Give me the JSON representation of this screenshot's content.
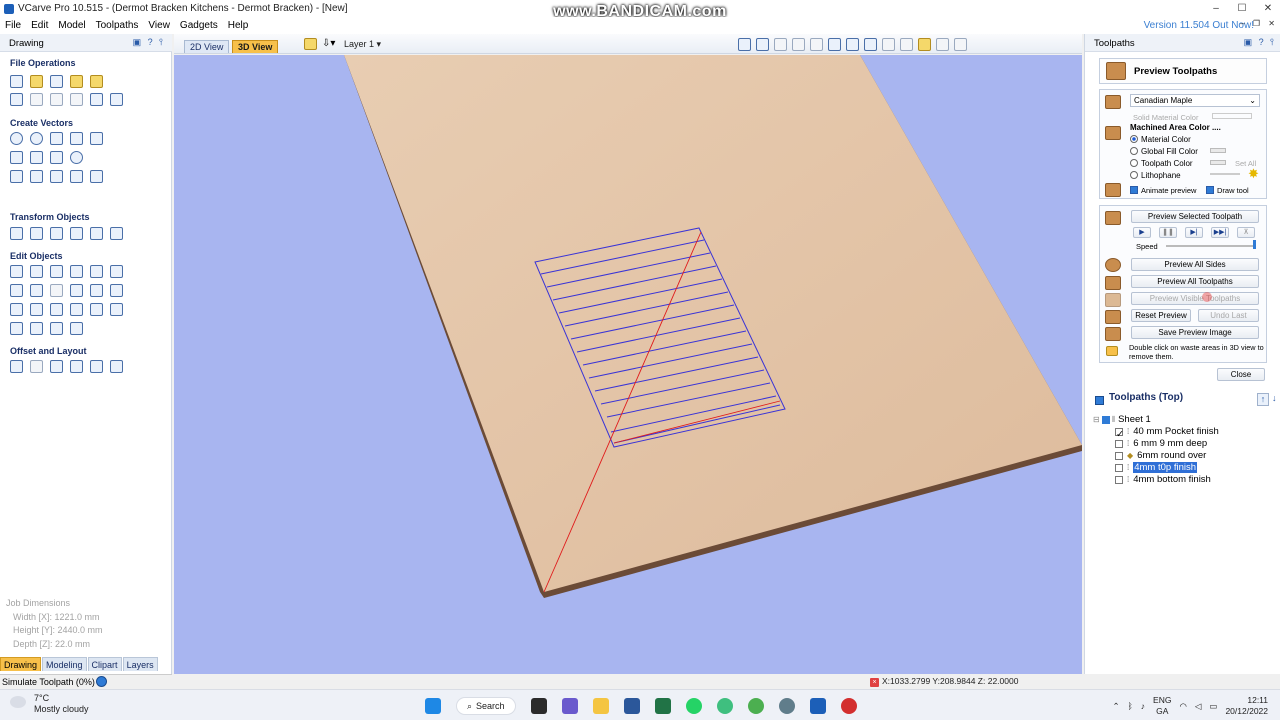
{
  "window": {
    "title": "VCarve Pro 10.515 - (Dermot Bracken Kitchens - Dermot Bracken) - [New]",
    "watermark": "www.BANDICAM.com",
    "minimize": "–",
    "maximize": "☐",
    "close": "✕",
    "mdi_controls": "– ❐ ✕"
  },
  "menu": [
    "File",
    "Edit",
    "Model",
    "Toolpaths",
    "View",
    "Gadgets",
    "Help"
  ],
  "version_link": "Version 11.504 Out Now!",
  "left_panel": {
    "header": "Drawing",
    "header_icons": "▣ ? ⫯",
    "sections": {
      "file_ops": "File Operations",
      "create_vectors": "Create Vectors",
      "transform": "Transform Objects",
      "edit": "Edit Objects",
      "offset": "Offset and Layout"
    },
    "job_dimensions": {
      "title": "Job Dimensions",
      "width": "Width  [X]: 1221.0 mm",
      "height": "Height [Y]: 2440.0 mm",
      "depth": "Depth  [Z]: 22.0 mm"
    },
    "tabs": [
      "Drawing",
      "Modeling",
      "Clipart",
      "Layers"
    ]
  },
  "view_toolbar": {
    "tab_2d": "2D View",
    "tab_3d": "3D View",
    "layer": "Layer 1 ▾"
  },
  "status": {
    "text": "Simulate Toolpath (0%)",
    "coords": "X:1033.2799 Y:208.9844 Z: 22.0000"
  },
  "right_panel": {
    "header": "Toolpaths",
    "header_icons": "▣ ? ⫯",
    "preview_title": "Preview Toolpaths",
    "material": "Canadian Maple",
    "solid_material_color": "Solid Material Color",
    "machined_area_color": "Machined Area Color ....",
    "radio_material": "Material Color",
    "radio_global": "Global Fill Color",
    "radio_toolpath": "Toolpath Color",
    "set_all": "Set All",
    "radio_litho": "Lithophane",
    "animate_preview": "Animate preview",
    "draw_tool": "Draw tool",
    "btn_preview_selected": "Preview Selected Toolpath",
    "speed_label": "Speed",
    "btn_preview_all_sides": "Preview All Sides",
    "btn_preview_all": "Preview All Toolpaths",
    "btn_preview_visible": "Preview Visible Toolpaths",
    "btn_reset": "Reset Preview",
    "btn_undo_last": "Undo Last",
    "btn_save_image": "Save Preview Image",
    "hint": "Double click on waste areas in 3D view to remove them.",
    "btn_close": "Close",
    "toolpaths_header": "Toolpaths (Top)",
    "sheet": "Sheet 1",
    "toolpaths": [
      {
        "name": "40 mm Pocket finish",
        "checked": true
      },
      {
        "name": "6 mm 9 mm deep",
        "checked": false
      },
      {
        "name": "6mm round over",
        "checked": false
      },
      {
        "name": "4mm t0p finish",
        "checked": false,
        "selected": true
      },
      {
        "name": "4mm bottom finish",
        "checked": false
      }
    ]
  },
  "taskbar": {
    "temp": "7°C",
    "weather": "Mostly cloudy",
    "search": "Search",
    "lang": "ENG",
    "region": "GA",
    "time": "12:11",
    "date": "20/12/2022"
  },
  "colors": {
    "viewport_bg": "#a8b5f0",
    "wood": "#e3c4a7",
    "toolpath": "#3a34d6",
    "accent_tab": "#f7c04a"
  }
}
